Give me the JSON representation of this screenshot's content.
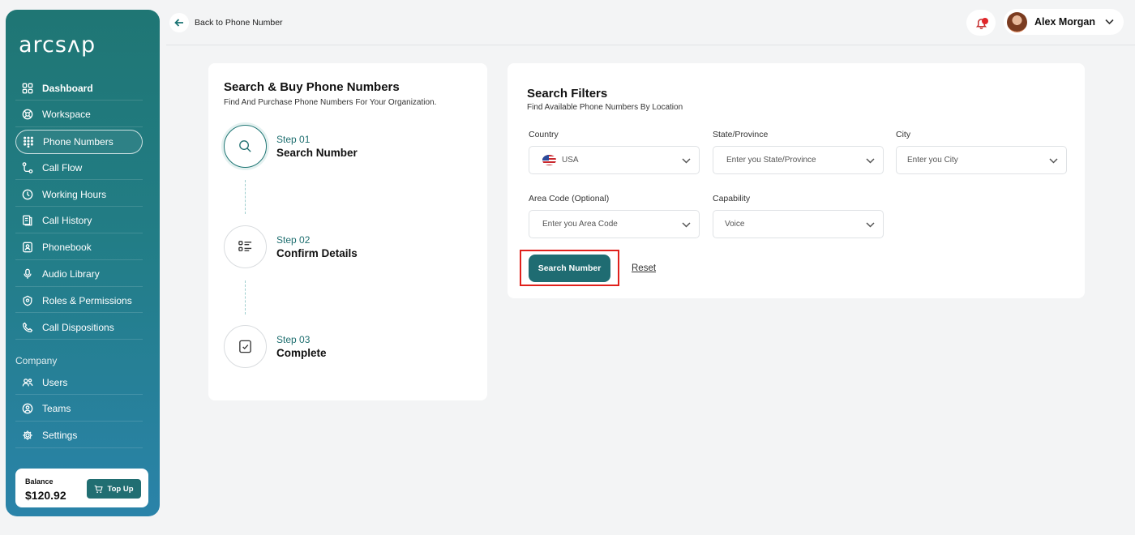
{
  "brand": {
    "logo_text": "arcsʌp"
  },
  "sidebar": {
    "items": [
      {
        "label": "Dashboard",
        "icon": "grid-icon"
      },
      {
        "label": "Workspace",
        "icon": "workspace-icon"
      },
      {
        "label": "Phone Numbers",
        "icon": "dialpad-icon"
      },
      {
        "label": "Call Flow",
        "icon": "flow-icon"
      },
      {
        "label": "Working Hours",
        "icon": "clock-icon"
      },
      {
        "label": "Call History",
        "icon": "history-icon"
      },
      {
        "label": "Phonebook",
        "icon": "contact-book-icon"
      },
      {
        "label": "Audio Library",
        "icon": "microphone-icon"
      },
      {
        "label": "Roles & Permissions",
        "icon": "shield-icon"
      },
      {
        "label": "Call Dispositions",
        "icon": "phone-icon"
      }
    ],
    "company_label": "Company",
    "company_items": [
      {
        "label": "Users",
        "icon": "users-icon"
      },
      {
        "label": "Teams",
        "icon": "teams-icon"
      },
      {
        "label": "Settings",
        "icon": "gear-icon"
      }
    ],
    "balance": {
      "label": "Balance",
      "value": "$120.92",
      "topup_label": "Top Up"
    }
  },
  "header": {
    "back_label": "Back to Phone Number",
    "user_name": "Alex Morgan"
  },
  "steps_card": {
    "title": "Search & Buy Phone Numbers",
    "subtitle": "Find And Purchase Phone Numbers For Your Organization.",
    "steps": [
      {
        "num": "Step 01",
        "name": "Search Number"
      },
      {
        "num": "Step 02",
        "name": "Confirm Details"
      },
      {
        "num": "Step 03",
        "name": "Complete"
      }
    ]
  },
  "filters": {
    "title": "Search Filters",
    "subtitle": "Find Available Phone Numbers By Location",
    "country": {
      "label": "Country",
      "value": "USA"
    },
    "state": {
      "label": "State/Province",
      "placeholder": "Enter you State/Province"
    },
    "city": {
      "label": "City",
      "placeholder": "Enter you City"
    },
    "area_code": {
      "label": "Area Code (Optional)",
      "placeholder": "Enter you Area Code"
    },
    "capability": {
      "label": "Capability",
      "value": "Voice"
    },
    "search_label": "Search Number",
    "reset_label": "Reset"
  },
  "colors": {
    "accent": "#1f6c72",
    "highlight": "#e0201b",
    "notification": "#e1262a"
  }
}
